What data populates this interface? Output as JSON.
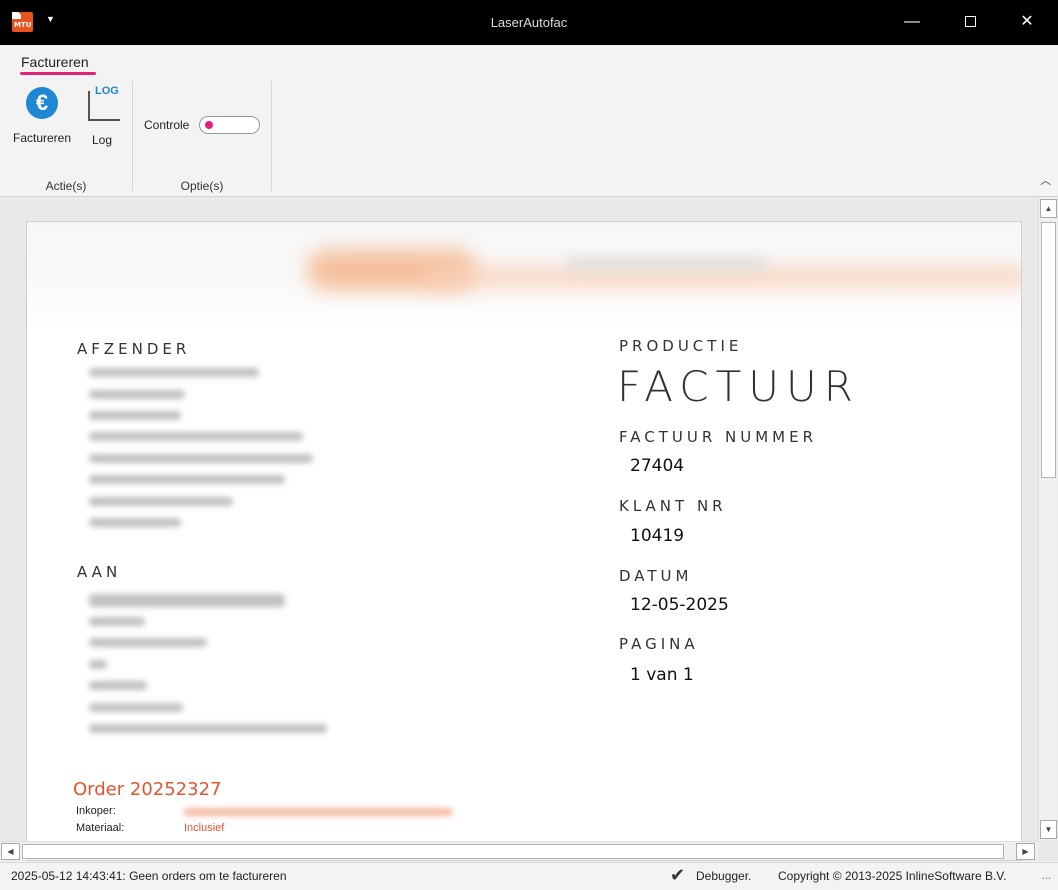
{
  "window": {
    "title": "LaserAutofac",
    "app_icon_text": "MTU"
  },
  "ribbon": {
    "tab": "Factureren",
    "buttons": [
      {
        "label": "Factureren",
        "icon": "euro-icon"
      },
      {
        "label": "Log",
        "icon": "log-chart-icon",
        "icon_text": "LOG"
      }
    ],
    "toggle_label": "Controle",
    "group_labels": [
      "Actie(s)",
      "Optie(s)"
    ],
    "accent_color": "#e0237a"
  },
  "invoice": {
    "sender_label": "AFZENDER",
    "recipient_label": "AAN",
    "doc_type_label": "PRODUCTIE",
    "doc_title": "FACTUUR",
    "invoice_number_label": "FACTUUR NUMMER",
    "invoice_number": "27404",
    "customer_number_label": "KLANT NR",
    "customer_number": "10419",
    "date_label": "DATUM",
    "date": "12-05-2025",
    "page_label": "PAGINA",
    "page": "1 van 1",
    "order_title": "Order 20252327",
    "buyer_label": "Inkoper:",
    "material_label": "Materiaal:",
    "material_value": "Inclusief",
    "highlight_color": "#e2552f"
  },
  "statusbar": {
    "message": "2025-05-12 14:43:41: Geen orders om te factureren",
    "debugger": "Debugger.",
    "copyright": "Copyright © 2013-2025 InlineSoftware B.V."
  }
}
